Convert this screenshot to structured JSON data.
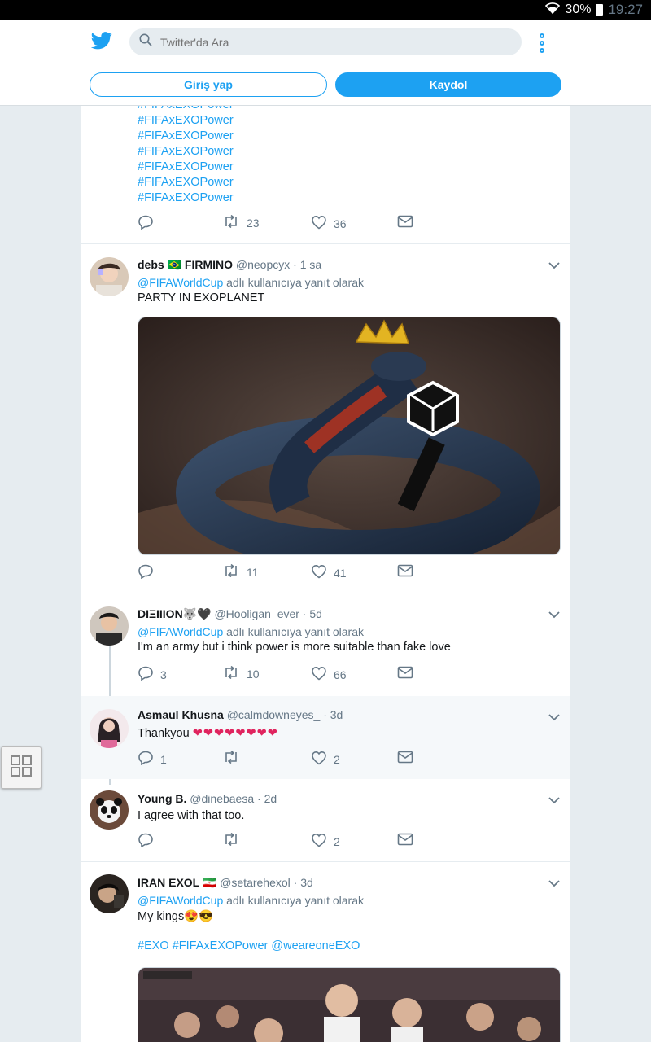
{
  "status_bar": {
    "battery": "30%",
    "time": "19:27"
  },
  "header": {
    "search_placeholder": "Twitter'da Ara",
    "login_label": "Giriş yap",
    "signup_label": "Kaydol"
  },
  "tweets": [
    {
      "hashtags": [
        "#FIFAxEXOPower",
        "#FIFAxEXOPower",
        "#FIFAxEXOPower",
        "#FIFAxEXOPower",
        "#FIFAxEXOPower",
        "#FIFAxEXOPower",
        "#FIFAxEXOPower"
      ],
      "retweets": "23",
      "likes": "36"
    },
    {
      "name": "debs 🇧🇷 FIRMINO",
      "handle": "@neopcyx",
      "time": "1 sa",
      "reply_to": "@FIFAWorldCup",
      "reply_suffix": "adlı kullanıcıya yanıt olarak",
      "text": "PARTY IN EXOPLANET",
      "retweets": "11",
      "likes": "41"
    },
    {
      "name": "DIΞIIION🐺🖤",
      "handle": "@Hooligan_ever",
      "time": "5d",
      "reply_to": "@FIFAWorldCup",
      "reply_suffix": "adlı kullanıcıya yanıt olarak",
      "text": "I'm an army but i think power is more suitable than fake love",
      "replies": "3",
      "retweets": "10",
      "likes": "66"
    },
    {
      "name": "Asmaul Khusna",
      "handle": "@calmdowneyes_",
      "time": "3d",
      "text": "Thankyou",
      "hearts": "❤❤❤❤❤❤❤❤",
      "replies": "1",
      "likes": "2"
    },
    {
      "name": "Young B.",
      "handle": "@dinebaesa",
      "time": "2d",
      "text": "I agree with that too.",
      "likes": "2"
    },
    {
      "name": "IRAN EXOL 🇮🇷",
      "handle": "@setarehexol",
      "time": "3d",
      "reply_to": "@FIFAWorldCup",
      "reply_suffix": "adlı kullanıcıya yanıt olarak",
      "text": "My kings😍😎",
      "tags": "#EXO #FIFAxEXOPower @weareoneEXO"
    }
  ],
  "colors": {
    "accent": "#1da1f2",
    "text": "#14171a",
    "muted": "#657786",
    "background": "#e6ecf0"
  }
}
